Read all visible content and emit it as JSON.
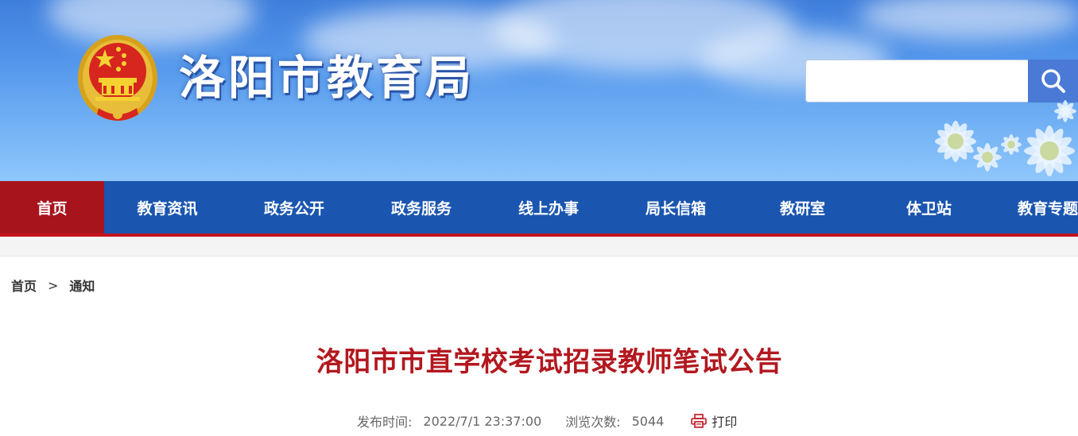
{
  "header": {
    "site_title": "洛阳市教育局",
    "search": {
      "value": "",
      "placeholder": ""
    }
  },
  "nav": {
    "items": [
      {
        "label": "首页",
        "active": true
      },
      {
        "label": "教育资讯"
      },
      {
        "label": "政务公开"
      },
      {
        "label": "政务服务"
      },
      {
        "label": "线上办事"
      },
      {
        "label": "局长信箱"
      },
      {
        "label": "教研室"
      },
      {
        "label": "体卫站"
      },
      {
        "label": "教育专题"
      }
    ]
  },
  "breadcrumb": {
    "home": "首页",
    "separator": ">",
    "current": "通知"
  },
  "article": {
    "title": "洛阳市市直学校考试招录教师笔试公告",
    "publish_label": "发布时间:",
    "publish_time": "2022/7/1 23:37:00",
    "views_label": "浏览次数:",
    "views": "5044",
    "print_label": "打印"
  },
  "colors": {
    "nav_bg": "#1a56b0",
    "nav_active": "#a8141c",
    "title_red": "#b3181f",
    "search_button": "#4a7ad6"
  },
  "icons": [
    "national-emblem-icon",
    "search-icon",
    "print-icon"
  ]
}
